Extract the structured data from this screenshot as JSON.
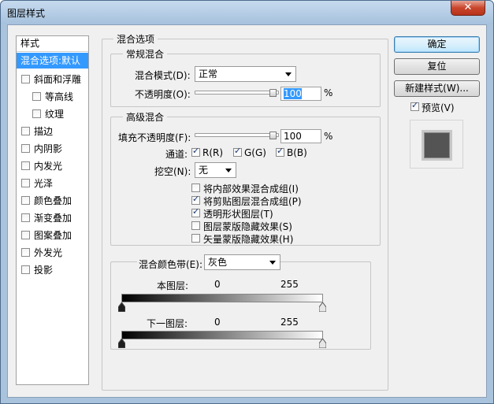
{
  "window": {
    "title": "图层样式",
    "close_glyph": "✕"
  },
  "style_list": {
    "header": "样式",
    "selected": "混合选项:默认",
    "items": [
      {
        "label": "斜面和浮雕",
        "checked": false
      },
      {
        "label": "等高线",
        "checked": false
      },
      {
        "label": "纹理",
        "checked": false
      },
      {
        "label": "描边",
        "checked": false
      },
      {
        "label": "内阴影",
        "checked": false
      },
      {
        "label": "内发光",
        "checked": false
      },
      {
        "label": "光泽",
        "checked": false
      },
      {
        "label": "颜色叠加",
        "checked": false
      },
      {
        "label": "渐变叠加",
        "checked": false
      },
      {
        "label": "图案叠加",
        "checked": false
      },
      {
        "label": "外发光",
        "checked": false
      },
      {
        "label": "投影",
        "checked": false
      }
    ]
  },
  "blend_options": {
    "title": "混合选项",
    "general": {
      "title": "常规混合",
      "mode_label": "混合模式(D):",
      "mode_value": "正常",
      "opacity_label": "不透明度(O):",
      "opacity_value": "100",
      "percent": "%"
    },
    "advanced": {
      "title": "高级混合",
      "fill_label": "填充不透明度(F):",
      "fill_value": "100",
      "percent": "%",
      "channels_label": "通道:",
      "channel_r": "R(R)",
      "channel_g": "G(G)",
      "channel_b": "B(B)",
      "knockout_label": "挖空(N):",
      "knockout_value": "无",
      "options": [
        {
          "label": "将内部效果混合成组(I)",
          "checked": false
        },
        {
          "label": "将剪贴图层混合成组(P)",
          "checked": true
        },
        {
          "label": "透明形状图层(T)",
          "checked": true
        },
        {
          "label": "图层蒙版隐藏效果(S)",
          "checked": false
        },
        {
          "label": "矢量蒙版隐藏效果(H)",
          "checked": false
        }
      ]
    },
    "blend_if": {
      "label": "混合颜色带(E):",
      "value": "灰色",
      "this_layer_label": "本图层:",
      "this_layer_min": "0",
      "this_layer_max": "255",
      "under_layer_label": "下一图层:",
      "under_layer_min": "0",
      "under_layer_max": "255"
    }
  },
  "buttons": {
    "ok": "确定",
    "reset": "复位",
    "new_style": "新建样式(W)...",
    "preview_label": "预览(V)",
    "preview_checked": true
  },
  "colors": {
    "accent": "#3399ff",
    "swatch": "#545454"
  }
}
